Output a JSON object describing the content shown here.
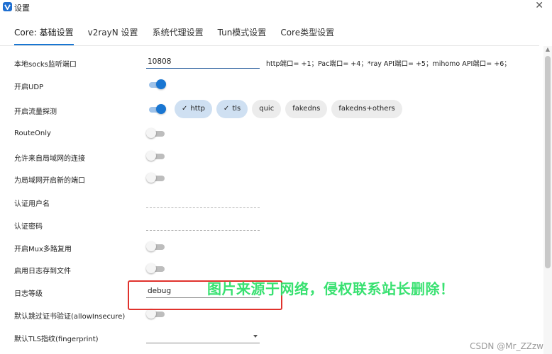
{
  "window": {
    "title": "设置",
    "close_glyph": "✕"
  },
  "tabs": [
    {
      "label": "Core: 基础设置",
      "active": true
    },
    {
      "label": "v2rayN 设置",
      "active": false
    },
    {
      "label": "系统代理设置",
      "active": false
    },
    {
      "label": "Tun模式设置",
      "active": false
    },
    {
      "label": "Core类型设置",
      "active": false
    }
  ],
  "settings": {
    "socks_port": {
      "label": "本地socks监听端口",
      "value": "10808",
      "hint": "http端口= +1；Pac端口= +4；*ray API端口= +5；mihomo API端口= +6；"
    },
    "udp": {
      "label": "开启UDP",
      "enabled": true
    },
    "sniffing": {
      "label": "开启流量探测",
      "enabled": true,
      "chips": [
        {
          "label": "http",
          "selected": true
        },
        {
          "label": "tls",
          "selected": true
        },
        {
          "label": "quic",
          "selected": false
        },
        {
          "label": "fakedns",
          "selected": false
        },
        {
          "label": "fakedns+others",
          "selected": false
        }
      ]
    },
    "route_only": {
      "label": "RouteOnly",
      "enabled": false
    },
    "allow_lan": {
      "label": "允许来自局域网的连接",
      "enabled": false
    },
    "lan_new_port": {
      "label": "为局域网开启新的端口",
      "enabled": false
    },
    "auth_user": {
      "label": "认证用户名",
      "value": ""
    },
    "auth_pass": {
      "label": "认证密码",
      "value": ""
    },
    "mux": {
      "label": "开启Mux多路复用",
      "enabled": false
    },
    "log_to_file": {
      "label": "启用日志存到文件",
      "enabled": false
    },
    "log_level": {
      "label": "日志等级",
      "value": "debug"
    },
    "allow_insecure": {
      "label": "默认跳过证书验证(allowInsecure)",
      "enabled": false
    },
    "fingerprint": {
      "label": "默认TLS指纹(fingerprint)",
      "value": ""
    }
  },
  "overlay": {
    "watermark": "图片来源于网络，侵权联系站长删除！",
    "credit": "CSDN @Mr_ZZzw",
    "highlight_color": "#e0322c",
    "watermark_color": "#2fe06a"
  },
  "colors": {
    "accent": "#1976d2",
    "chip_selected": "#cfe0f2",
    "chip_default": "#ececec"
  },
  "icons": {
    "app": "v2rayn-logo-icon",
    "check": "check-icon",
    "dropdown": "chevron-down-icon"
  }
}
